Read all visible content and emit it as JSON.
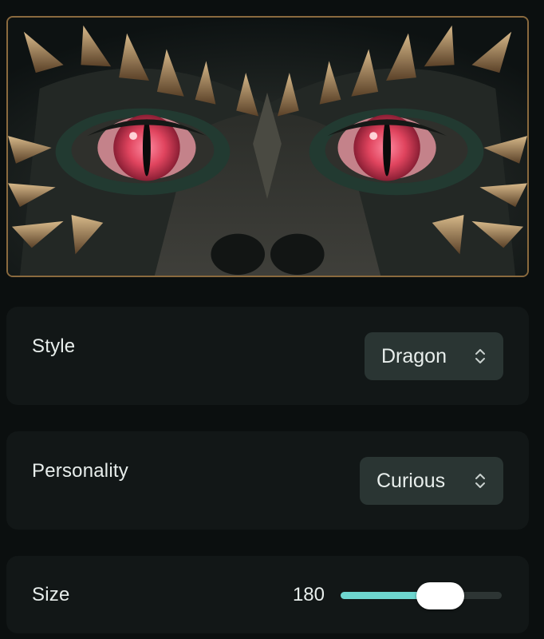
{
  "preview": {
    "image": "dragon-eyes-illustration"
  },
  "style": {
    "label": "Style",
    "value": "Dragon",
    "icon": "chevron-up-down-icon"
  },
  "personality": {
    "label": "Personality",
    "value": "Curious",
    "icon": "chevron-up-down-icon"
  },
  "size": {
    "label": "Size",
    "value": "180",
    "fill_fraction": 0.62
  },
  "colors": {
    "background": "#0b0f0f",
    "card": "#121717",
    "select": "#2a3533",
    "slider_fill": "#6ed6cf",
    "slider_track": "#2d3534",
    "eye_iris": "#e0445e",
    "frame_border": "#8a6a3e"
  }
}
